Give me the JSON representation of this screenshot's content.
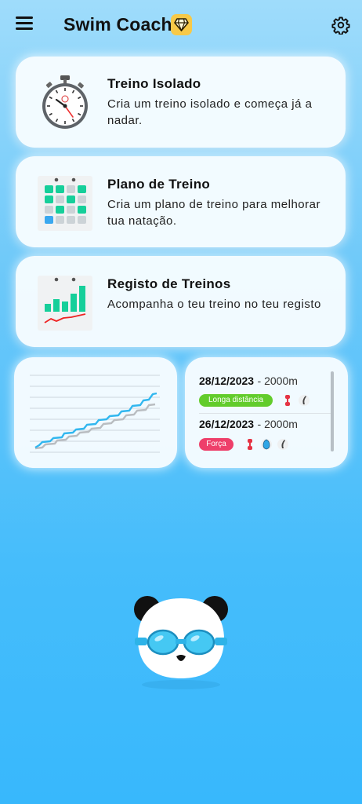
{
  "app": {
    "title": "Swim Coach"
  },
  "icons": {
    "menu": "menu-icon",
    "premium": "diamond-icon",
    "settings": "gear-icon"
  },
  "cards": [
    {
      "title": "Treino Isolado",
      "desc": "Cria um treino isolado e começa já a nadar.",
      "icon": "stopwatch-icon"
    },
    {
      "title": "Plano de Treino",
      "desc": "Cria um plano de treino para melhorar tua natação.",
      "icon": "calendar-icon"
    },
    {
      "title": "Registo de Treinos",
      "desc": "Acompanha o teu treino no teu registo",
      "icon": "bar-chart-icon"
    }
  ],
  "history": [
    {
      "date": "28/12/2023",
      "distance": "- 2000m",
      "tag": "Longa distância",
      "tag_color": "#62cc2b",
      "gear": [
        "pull-buoy-icon",
        "fins-icon"
      ]
    },
    {
      "date": "26/12/2023",
      "distance": "- 2000m",
      "tag": "Força",
      "tag_color": "#ee3f6a",
      "gear": [
        "pull-buoy-icon",
        "paddles-icon",
        "fins-icon"
      ]
    }
  ],
  "colors": {
    "accent": "#38b8fc",
    "card": "#f6fcff",
    "green_tag": "#62cc2b",
    "red_tag": "#ee3f6a",
    "premium": "#f7c948"
  }
}
